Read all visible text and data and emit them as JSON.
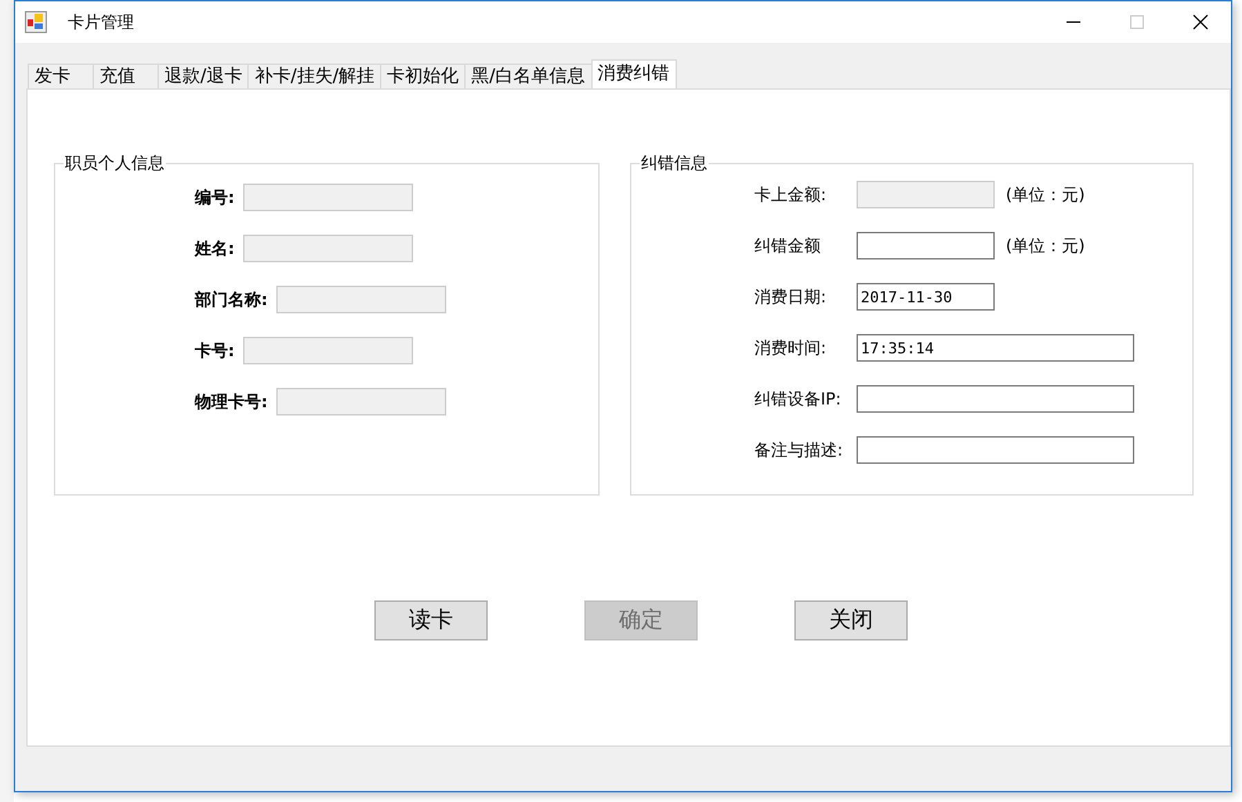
{
  "window": {
    "title": "卡片管理",
    "maximize_disabled": true
  },
  "tabs": [
    {
      "label": "发卡",
      "selected": false
    },
    {
      "label": "充值",
      "selected": false
    },
    {
      "label": "退款/退卡",
      "selected": false
    },
    {
      "label": "补卡/挂失/解挂",
      "selected": false
    },
    {
      "label": "卡初始化",
      "selected": false
    },
    {
      "label": "黑/白名单信息",
      "selected": false
    },
    {
      "label": "消费纠错",
      "selected": true
    }
  ],
  "groups": [
    {
      "title": "职员个人信息",
      "bold_labels": true,
      "fields": [
        {
          "label": "编号:",
          "disabled": true,
          "kind": "short"
        },
        {
          "label": "姓名:",
          "disabled": true,
          "kind": "short"
        },
        {
          "label": "部门名称:",
          "disabled": true,
          "kind": "short"
        },
        {
          "label": "卡号:",
          "disabled": true,
          "kind": "short"
        },
        {
          "label": "物理卡号:",
          "disabled": true,
          "kind": "short"
        }
      ]
    },
    {
      "title": "纠错信息",
      "bold_labels": false,
      "fields": [
        {
          "label": "卡上金额:",
          "disabled": true,
          "kind": "short",
          "unit": "(单位：元)"
        },
        {
          "label": "纠错金额",
          "disabled": false,
          "kind": "short",
          "unit": "(单位：元)"
        },
        {
          "label": "消费日期:",
          "disabled": false,
          "kind": "short",
          "value": "2017-11-30"
        },
        {
          "label": "消费时间:",
          "disabled": false,
          "kind": "long",
          "value": "17:35:14"
        },
        {
          "label": "纠错设备IP:",
          "disabled": false,
          "kind": "long"
        },
        {
          "label": "备注与描述:",
          "disabled": false,
          "kind": "long"
        }
      ]
    }
  ],
  "buttons": [
    {
      "label": "读卡",
      "disabled": false
    },
    {
      "label": "确定",
      "disabled": true
    },
    {
      "label": "关闭",
      "disabled": false
    }
  ]
}
